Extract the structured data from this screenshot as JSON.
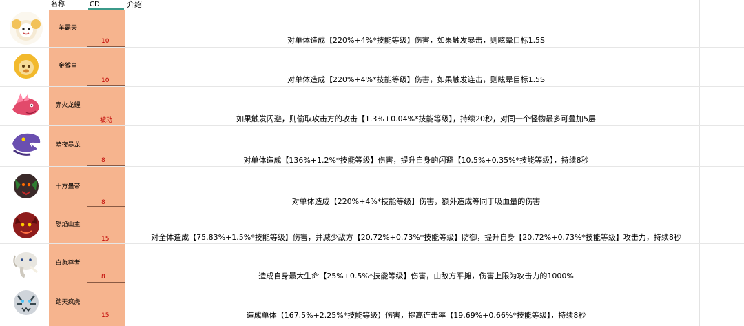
{
  "header": {
    "name_label": "名称",
    "cd_label": "CD",
    "desc_label": "介绍"
  },
  "rows": [
    {
      "name": "羊霸天",
      "cd": "10",
      "desc": "对单体造成【220%+4%*技能等级】伤害，如果触发暴击，则眩晕目标1.5S"
    },
    {
      "name": "金猴皇",
      "cd": "10",
      "desc": "对单体造成【220%+4%*技能等级】伤害，如果触发连击，则眩晕目标1.5S"
    },
    {
      "name": "赤火龙鲤",
      "cd": "被动",
      "desc": "如果触发闪避，则偷取攻击方的攻击【1.3%+0.04%*技能等级】，持续20秒，对同一个怪物最多可叠加5层"
    },
    {
      "name": "暗夜暴龙",
      "cd": "8",
      "desc": "对单体造成【136%+1.2%*技能等级】伤害，提升自身的闪避【10.5%+0.35%*技能等级】，持续8秒"
    },
    {
      "name": "十方蛊帝",
      "cd": "8",
      "desc": "对单体造成【220%+4%*技能等级】伤害，额外造成等同于吸血量的伤害"
    },
    {
      "name": "怒焰山主",
      "cd": "15",
      "desc": "对全体造成【75.83%+1.5%*技能等级】伤害，并减少敌方【20.72%+0.73%*技能等级】防御，提升自身【20.72%+0.73%*技能等级】攻击力，持续8秒"
    },
    {
      "name": "白象尊者",
      "cd": "8",
      "desc": "造成自身最大生命【25%+0.5%*技能等级】伤害，由敌方平摊，伤害上限为攻击力的1000%"
    },
    {
      "name": "踏天疯虎",
      "cd": "15",
      "desc": "造成单体【167.5%+2.25%*技能等级】伤害，提高连击率【19.69%+0.66%*技能等级】，持续8秒"
    }
  ]
}
